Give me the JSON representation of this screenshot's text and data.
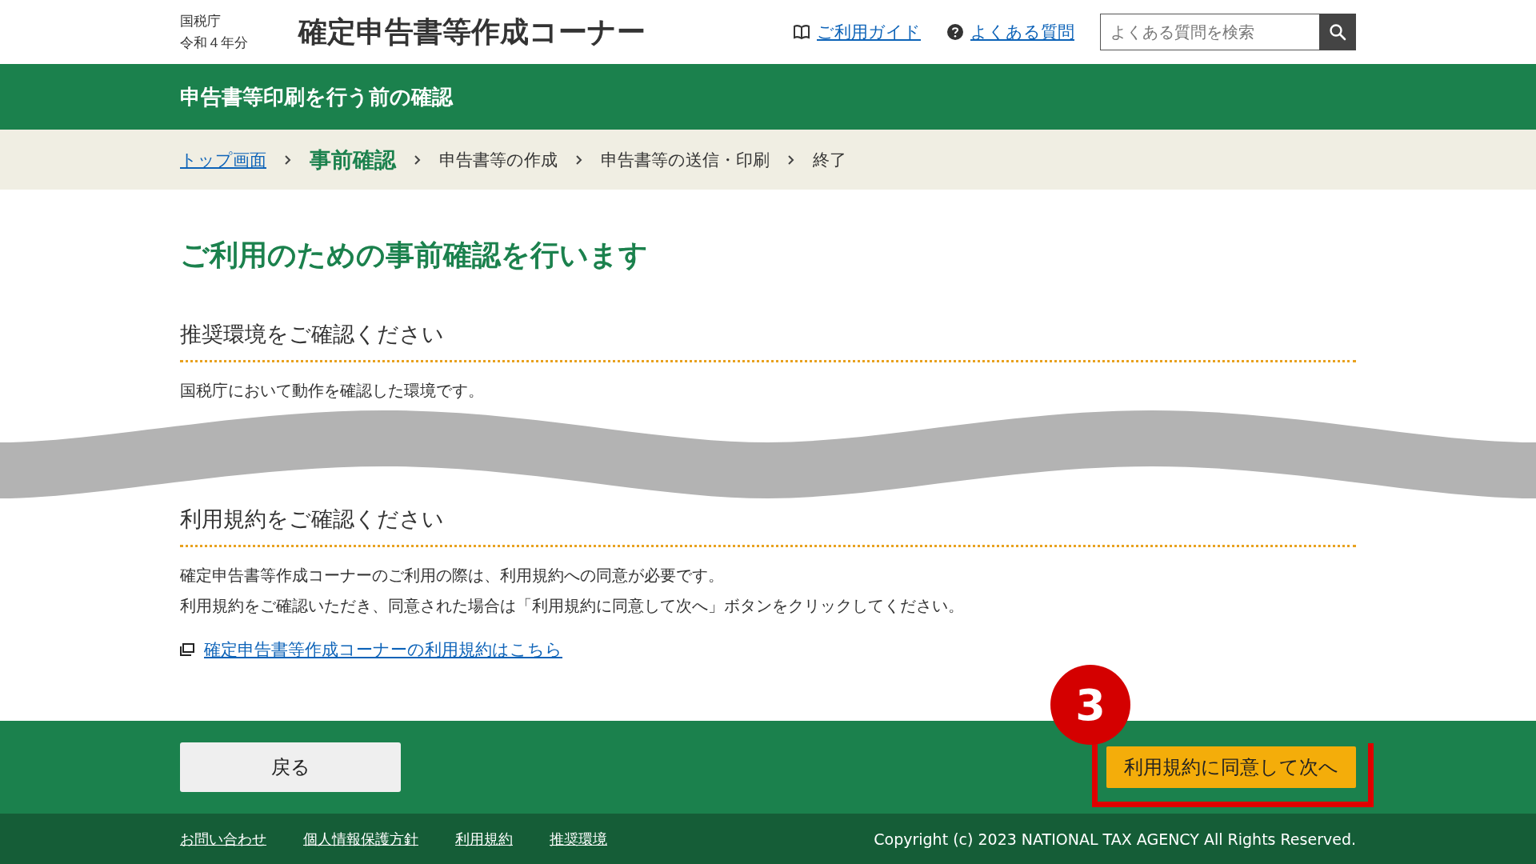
{
  "header": {
    "agency": "国税庁",
    "year": "令和４年分",
    "site_title": "確定申告書等作成コーナー",
    "links": [
      {
        "kind": "guide",
        "label": "ご利用ガイド"
      },
      {
        "kind": "faq",
        "label": "よくある質問"
      }
    ],
    "search": {
      "placeholder": "よくある質問を検索"
    }
  },
  "page_band": {
    "title": "申告書等印刷を行う前の確認"
  },
  "breadcrumb": [
    {
      "label": "トップ画面",
      "kind": "link"
    },
    {
      "label": "事前確認",
      "kind": "current"
    },
    {
      "label": "申告書等の作成",
      "kind": "step"
    },
    {
      "label": "申告書等の送信・印刷",
      "kind": "step"
    },
    {
      "label": "終了",
      "kind": "step"
    }
  ],
  "heading": "ご利用のための事前確認を行います",
  "sections": [
    {
      "title": "推奨環境をご確認ください",
      "paragraphs": [
        "国税庁において動作を確認した環境です。"
      ],
      "cut_after": true
    },
    {
      "title": "利用規約をご確認ください",
      "paragraphs": [
        "確定申告書等作成コーナーのご利用の際は、利用規約への同意が必要です。",
        "利用規約をご確認いただき、同意された場合は「利用規約に同意して次へ」ボタンをクリックしてください。"
      ],
      "link": "確定申告書等作成コーナーの利用規約はこちら",
      "cut_after": false
    }
  ],
  "actions": {
    "back": "戻る",
    "next": "利用規約に同意して次へ",
    "annotation": {
      "number": "3"
    }
  },
  "footer": {
    "links": [
      "お問い合わせ",
      "個人情報保護方針",
      "利用規約",
      "推奨環境"
    ],
    "copyright": "Copyright (c) 2023 NATIONAL TAX AGENCY All Rights Reserved."
  }
}
